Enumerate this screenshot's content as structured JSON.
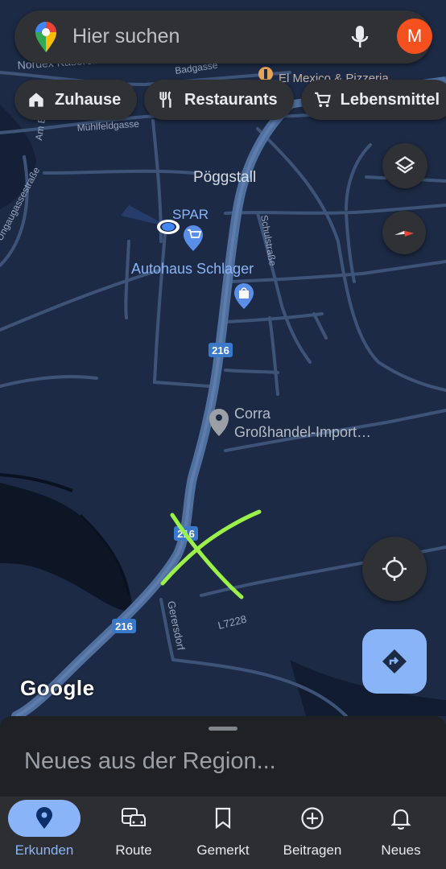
{
  "search": {
    "placeholder": "Hier suchen",
    "avatar_letter": "M"
  },
  "chips": [
    {
      "label": "Zuhause",
      "icon": "home-icon"
    },
    {
      "label": "Restaurants",
      "icon": "restaurant-icon"
    },
    {
      "label": "Lebensmittel",
      "icon": "cart-icon"
    }
  ],
  "map": {
    "places": {
      "town": "Pöggstall",
      "spar": "SPAR",
      "autohaus": "Autohaus Schlager",
      "corra_1": "Corra",
      "corra_2": "Großhandel-Import…",
      "restaurant": "El Mexico & Pizzeria",
      "nordex": "Nordex Kaserei"
    },
    "streets": {
      "badgasse": "Badgasse",
      "muehlfeldgasse": "Mühlfeldgasse",
      "am_bach": "Am Bach",
      "schulstrasse": "Schulstraße",
      "gerersdorf": "Gerersdorf",
      "l7228": "L7228",
      "wolfgang": "Ungaugassestraße"
    },
    "road_badges": [
      "216",
      "216",
      "216"
    ],
    "attribution": "Google"
  },
  "colors": {
    "background": "#1c2a45",
    "road": "#4f6f9f",
    "minor_road": "#3d5478",
    "water": "#0e1626",
    "accent": "#8ab4f8",
    "annotation": "#9cf04a"
  },
  "sheet": {
    "title": "Neues aus der Region..."
  },
  "nav": [
    {
      "label": "Erkunden",
      "icon": "location-pin-icon",
      "active": true
    },
    {
      "label": "Route",
      "icon": "commute-icon",
      "active": false
    },
    {
      "label": "Gemerkt",
      "icon": "bookmark-icon",
      "active": false
    },
    {
      "label": "Beitragen",
      "icon": "add-circle-icon",
      "active": false
    },
    {
      "label": "Neues",
      "icon": "bell-icon",
      "active": false
    }
  ]
}
